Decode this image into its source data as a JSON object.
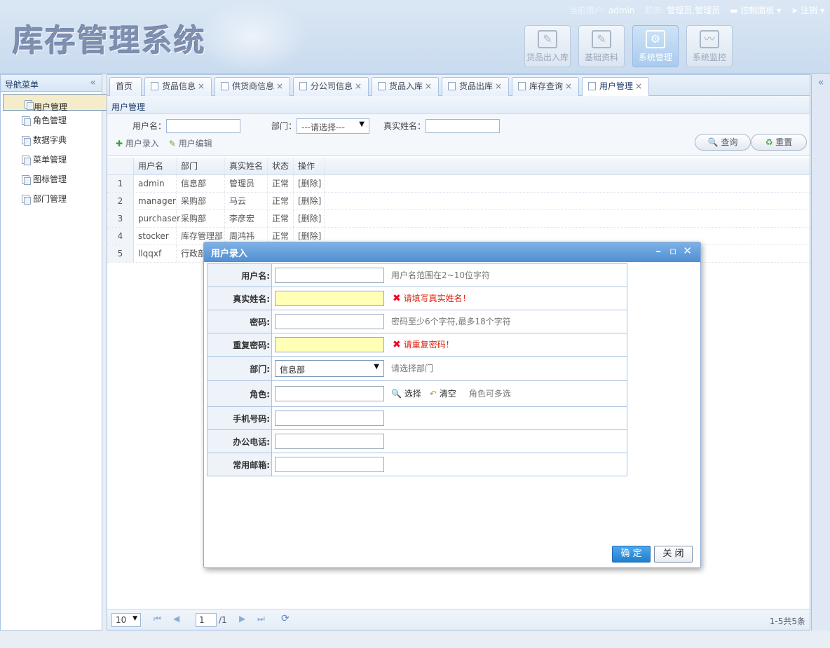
{
  "app": {
    "title": "库存管理系统"
  },
  "userbar": {
    "user_label": "当前用户: ",
    "user_value": "admin",
    "role_label": "职务: ",
    "role_value": "管理员,管理员",
    "control_panel": "控制面板",
    "logout": "注销"
  },
  "top_buttons": [
    {
      "label": "货品出入库",
      "icon": "edit-icon"
    },
    {
      "label": "基础资料",
      "icon": "edit-icon"
    },
    {
      "label": "系统管理",
      "icon": "settings-icon"
    },
    {
      "label": "系统监控",
      "icon": "monitor-icon"
    }
  ],
  "sidebar": {
    "title": "导航菜单",
    "items": [
      {
        "label": "用户管理"
      },
      {
        "label": "角色管理"
      },
      {
        "label": "数据字典"
      },
      {
        "label": "菜单管理"
      },
      {
        "label": "图标管理"
      },
      {
        "label": "部门管理"
      }
    ]
  },
  "tabs": [
    {
      "label": "首页"
    },
    {
      "label": "货品信息"
    },
    {
      "label": "供货商信息"
    },
    {
      "label": "分公司信息"
    },
    {
      "label": "货品入库"
    },
    {
      "label": "货品出库"
    },
    {
      "label": "库存查询"
    },
    {
      "label": "用户管理"
    }
  ],
  "panel": {
    "title": "用户管理"
  },
  "search": {
    "username_label": "用户名：",
    "dept_label": "部门：",
    "dept_value": "---请选择---",
    "realname_label": "真实姓名：",
    "add_label": "用户录入",
    "edit_label": "用户编辑",
    "query_label": "查询",
    "reset_label": "重置"
  },
  "grid": {
    "headers": [
      "用户名",
      "部门",
      "真实姓名",
      "状态",
      "操作"
    ],
    "rows": [
      {
        "no": "1",
        "username": "admin",
        "dept": "信息部",
        "realname": "管理员",
        "status": "正常",
        "action": "[删除]"
      },
      {
        "no": "2",
        "username": "manager",
        "dept": "采购部",
        "realname": "马云",
        "status": "正常",
        "action": "[删除]"
      },
      {
        "no": "3",
        "username": "purchaser",
        "dept": "采购部",
        "realname": "李彦宏",
        "status": "正常",
        "action": "[删除]"
      },
      {
        "no": "4",
        "username": "stocker",
        "dept": "库存管理部",
        "realname": "周鸿祎",
        "status": "正常",
        "action": "[删除]"
      },
      {
        "no": "5",
        "username": "llqqxf",
        "dept": "行政部",
        "realname": "",
        "status": "",
        "action": ""
      }
    ]
  },
  "pager": {
    "page_size": "10",
    "page": "1",
    "total_pages": "/1",
    "summary": "1-5共5条"
  },
  "dialog": {
    "title": "用户录入",
    "fields": {
      "username": {
        "label": "用户名:",
        "hint": "用户名范围在2~10位字符"
      },
      "realname": {
        "label": "真实姓名:",
        "error": "请填写真实姓名！"
      },
      "password": {
        "label": "密码:",
        "hint": "密码至少6个字符,最多18个字符"
      },
      "password2": {
        "label": "重复密码:",
        "error": "请重复密码！"
      },
      "dept": {
        "label": "部门:",
        "value": "信息部",
        "hint": "请选择部门"
      },
      "role": {
        "label": "角色:",
        "select": "选择",
        "clear": "清空",
        "hint": "角色可多选"
      },
      "mobile": {
        "label": "手机号码:"
      },
      "phone": {
        "label": "办公电话:"
      },
      "email": {
        "label": "常用邮箱:"
      }
    },
    "ok": "确 定",
    "close": "关 闭"
  }
}
